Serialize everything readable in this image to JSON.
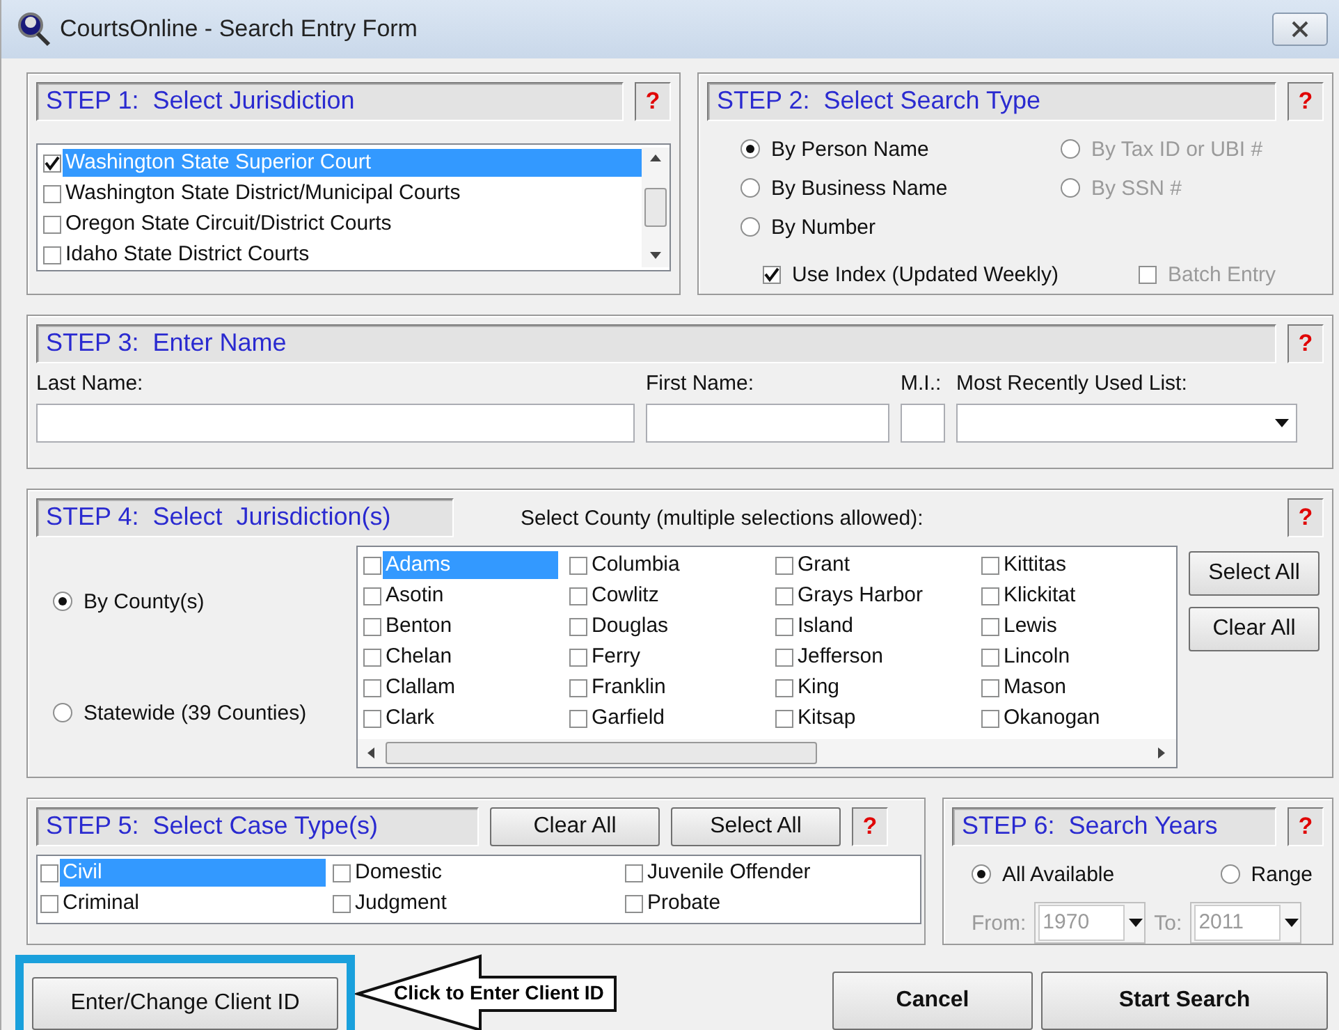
{
  "window": {
    "title": "CourtsOnline - Search Entry Form"
  },
  "step1": {
    "title": "STEP 1:  Select Jurisdiction",
    "help": "?",
    "items": [
      {
        "label": "Washington State Superior Court",
        "checked": true,
        "selected": true
      },
      {
        "label": "Washington State District/Municipal Courts",
        "checked": false,
        "selected": false
      },
      {
        "label": "Oregon State Circuit/District Courts",
        "checked": false,
        "selected": false
      },
      {
        "label": "Idaho State District Courts",
        "checked": false,
        "selected": false
      }
    ]
  },
  "step2": {
    "title": "STEP 2:  Select Search Type",
    "help": "?",
    "options": [
      {
        "label": "By Person Name",
        "selected": true,
        "disabled": false
      },
      {
        "label": "By Tax ID or UBI #",
        "selected": false,
        "disabled": true
      },
      {
        "label": "By Business Name",
        "selected": false,
        "disabled": false
      },
      {
        "label": "By SSN #",
        "selected": false,
        "disabled": true
      },
      {
        "label": "By Number",
        "selected": false,
        "disabled": false
      }
    ],
    "checkboxes": [
      {
        "label": "Use Index (Updated Weekly)",
        "checked": true,
        "disabled": false
      },
      {
        "label": "Batch Entry",
        "checked": false,
        "disabled": true
      }
    ]
  },
  "step3": {
    "title": "STEP 3:  Enter Name",
    "help": "?",
    "fields": [
      {
        "label": "Last Name:",
        "kind": "text"
      },
      {
        "label": "First Name:",
        "kind": "text"
      },
      {
        "label": "M.I.:",
        "kind": "text"
      },
      {
        "label": "Most Recently Used List:",
        "kind": "dropdown"
      }
    ]
  },
  "step4": {
    "title": "STEP 4:  Select  Jurisdiction(s)",
    "caption": "Select County (multiple selections allowed):",
    "help": "?",
    "scopes": [
      {
        "label": "By County(s)",
        "selected": true
      },
      {
        "label": "Statewide (39 Counties)",
        "selected": false
      }
    ],
    "counties": [
      {
        "label": "Adams",
        "checked": false,
        "selected": true
      },
      {
        "label": "Asotin",
        "checked": false,
        "selected": false
      },
      {
        "label": "Benton",
        "checked": false,
        "selected": false
      },
      {
        "label": "Chelan",
        "checked": false,
        "selected": false
      },
      {
        "label": "Clallam",
        "checked": false,
        "selected": false
      },
      {
        "label": "Clark",
        "checked": false,
        "selected": false
      },
      {
        "label": "Columbia",
        "checked": false,
        "selected": false
      },
      {
        "label": "Cowlitz",
        "checked": false,
        "selected": false
      },
      {
        "label": "Douglas",
        "checked": false,
        "selected": false
      },
      {
        "label": "Ferry",
        "checked": false,
        "selected": false
      },
      {
        "label": "Franklin",
        "checked": false,
        "selected": false
      },
      {
        "label": "Garfield",
        "checked": false,
        "selected": false
      },
      {
        "label": "Grant",
        "checked": false,
        "selected": false
      },
      {
        "label": "Grays Harbor",
        "checked": false,
        "selected": false
      },
      {
        "label": "Island",
        "checked": false,
        "selected": false
      },
      {
        "label": "Jefferson",
        "checked": false,
        "selected": false
      },
      {
        "label": "King",
        "checked": false,
        "selected": false
      },
      {
        "label": "Kitsap",
        "checked": false,
        "selected": false
      },
      {
        "label": "Kittitas",
        "checked": false,
        "selected": false
      },
      {
        "label": "Klickitat",
        "checked": false,
        "selected": false
      },
      {
        "label": "Lewis",
        "checked": false,
        "selected": false
      },
      {
        "label": "Lincoln",
        "checked": false,
        "selected": false
      },
      {
        "label": "Mason",
        "checked": false,
        "selected": false
      },
      {
        "label": "Okanogan",
        "checked": false,
        "selected": false
      }
    ],
    "buttons": [
      "Select All",
      "Clear All"
    ]
  },
  "step5": {
    "title": "STEP 5:  Select Case Type(s)",
    "buttons": [
      "Clear All",
      "Select All"
    ],
    "help": "?",
    "case_types": [
      {
        "label": "Civil",
        "checked": false,
        "selected": true
      },
      {
        "label": "Criminal",
        "checked": false,
        "selected": false
      },
      {
        "label": "Domestic",
        "checked": false,
        "selected": false
      },
      {
        "label": "Judgment",
        "checked": false,
        "selected": false
      },
      {
        "label": "Juvenile Offender",
        "checked": false,
        "selected": false
      },
      {
        "label": "Probate",
        "checked": false,
        "selected": false
      }
    ]
  },
  "step6": {
    "title": "STEP 6:  Search Years",
    "help": "?",
    "options": [
      {
        "label": "All Available",
        "selected": true
      },
      {
        "label": "Range",
        "selected": false
      }
    ],
    "from": {
      "label": "From:",
      "value": "1970",
      "disabled": true
    },
    "to": {
      "label": "To:",
      "value": "2011",
      "disabled": true
    }
  },
  "footer": {
    "client_button": "Enter/Change Client ID",
    "callout": "Click to Enter Client ID",
    "buttons": [
      "Cancel",
      "Start Search"
    ]
  }
}
